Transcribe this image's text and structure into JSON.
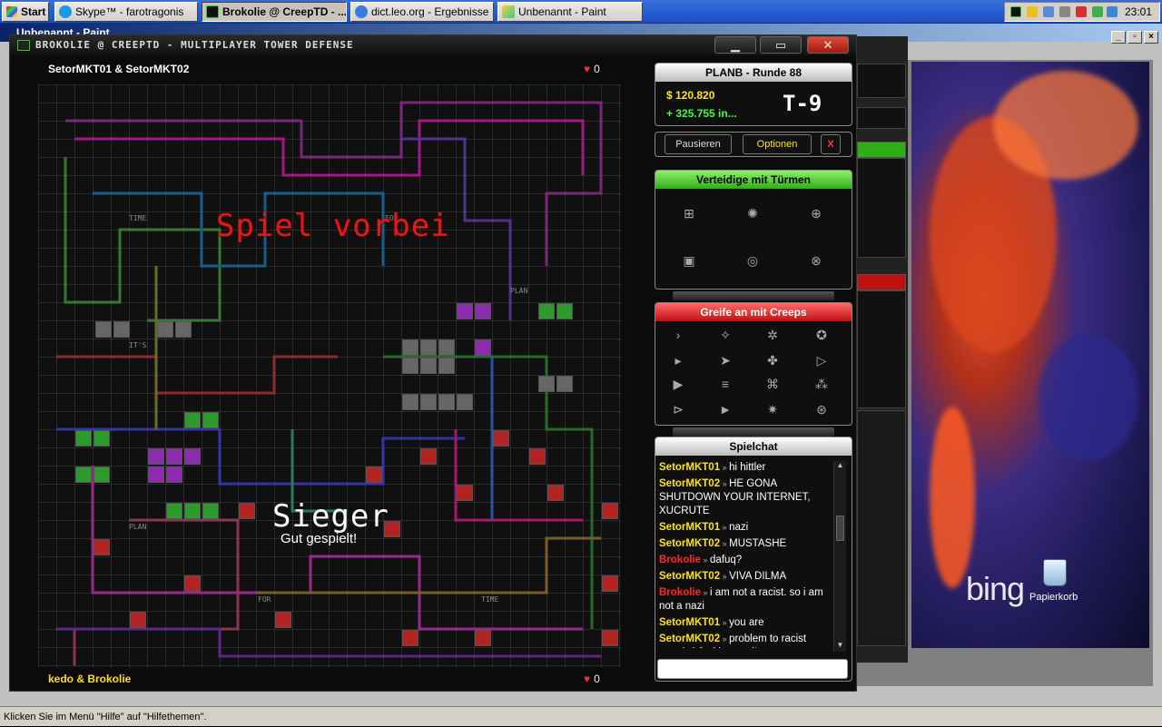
{
  "taskbar": {
    "start": "Start",
    "tasks": [
      {
        "label": "Skype™ - farotragonis",
        "active": false
      },
      {
        "label": "Brokolie @ CreepTD - ...",
        "active": true
      },
      {
        "label": "dict.leo.org - Ergebnisse ...",
        "active": false
      },
      {
        "label": "Unbenannt - Paint",
        "active": false
      }
    ],
    "clock": "23:01"
  },
  "paint": {
    "title": "Unbenannt - Paint",
    "status": "Klicken Sie im Menü \"Hilfe\" auf \"Hilfethemen\".",
    "desktop": {
      "brand": "bing",
      "recycle_bin": "Papierkorb"
    }
  },
  "game": {
    "window_title": "BROKOLIE @ CREEPTD - MULTIPLAYER TOWER DEFENSE",
    "top_team": "SetorMKT01 & SetorMKT02",
    "top_lives": "0",
    "bottom_team": "kedo & Brokolie",
    "bottom_lives": "0",
    "game_over": "Spiel vorbei",
    "winner": "Sieger",
    "well_played": "Gut gespielt!",
    "board_labels": [
      "TIME",
      "FOR",
      "IT'S",
      "PLAN",
      "PLAN",
      "FOR",
      "TIME"
    ]
  },
  "sidebar": {
    "status": {
      "header": "PLANB - Runde 88",
      "money": "$ 120.820",
      "income": "+ 325.755 in...",
      "timer": "T-9"
    },
    "buttons": {
      "pause": "Pausieren",
      "options": "Optionen",
      "close": "X"
    },
    "towers_header": "Verteidige mit Türmen",
    "creeps_header": "Greife an mit Creeps",
    "chat": {
      "header": "Spielchat",
      "messages": [
        {
          "user": "SetorMKT01",
          "team": "yellow",
          "text": "hi hittler"
        },
        {
          "user": "SetorMKT02",
          "team": "yellow",
          "text": "HE GONA SHUTDOWN YOUR INTERNET, XUCRUTE"
        },
        {
          "user": "SetorMKT01",
          "team": "yellow",
          "text": "nazi"
        },
        {
          "user": "SetorMKT02",
          "team": "yellow",
          "text": "MUSTASHE"
        },
        {
          "user": "Brokolie",
          "team": "red",
          "text": "dafuq?"
        },
        {
          "user": "SetorMKT02",
          "team": "yellow",
          "text": "VIVA DILMA"
        },
        {
          "user": "Brokolie",
          "team": "red",
          "text": "i am not a racist. so i am not a nazi"
        },
        {
          "user": "SetorMKT01",
          "team": "yellow",
          "text": "you are"
        },
        {
          "user": "SetorMKT02",
          "team": "yellow",
          "text": "problem to racist people? fucking nazi!"
        }
      ]
    }
  },
  "colors": {
    "accent_green": "#2fae18",
    "accent_red": "#c01010",
    "money": "#ffe41a"
  }
}
